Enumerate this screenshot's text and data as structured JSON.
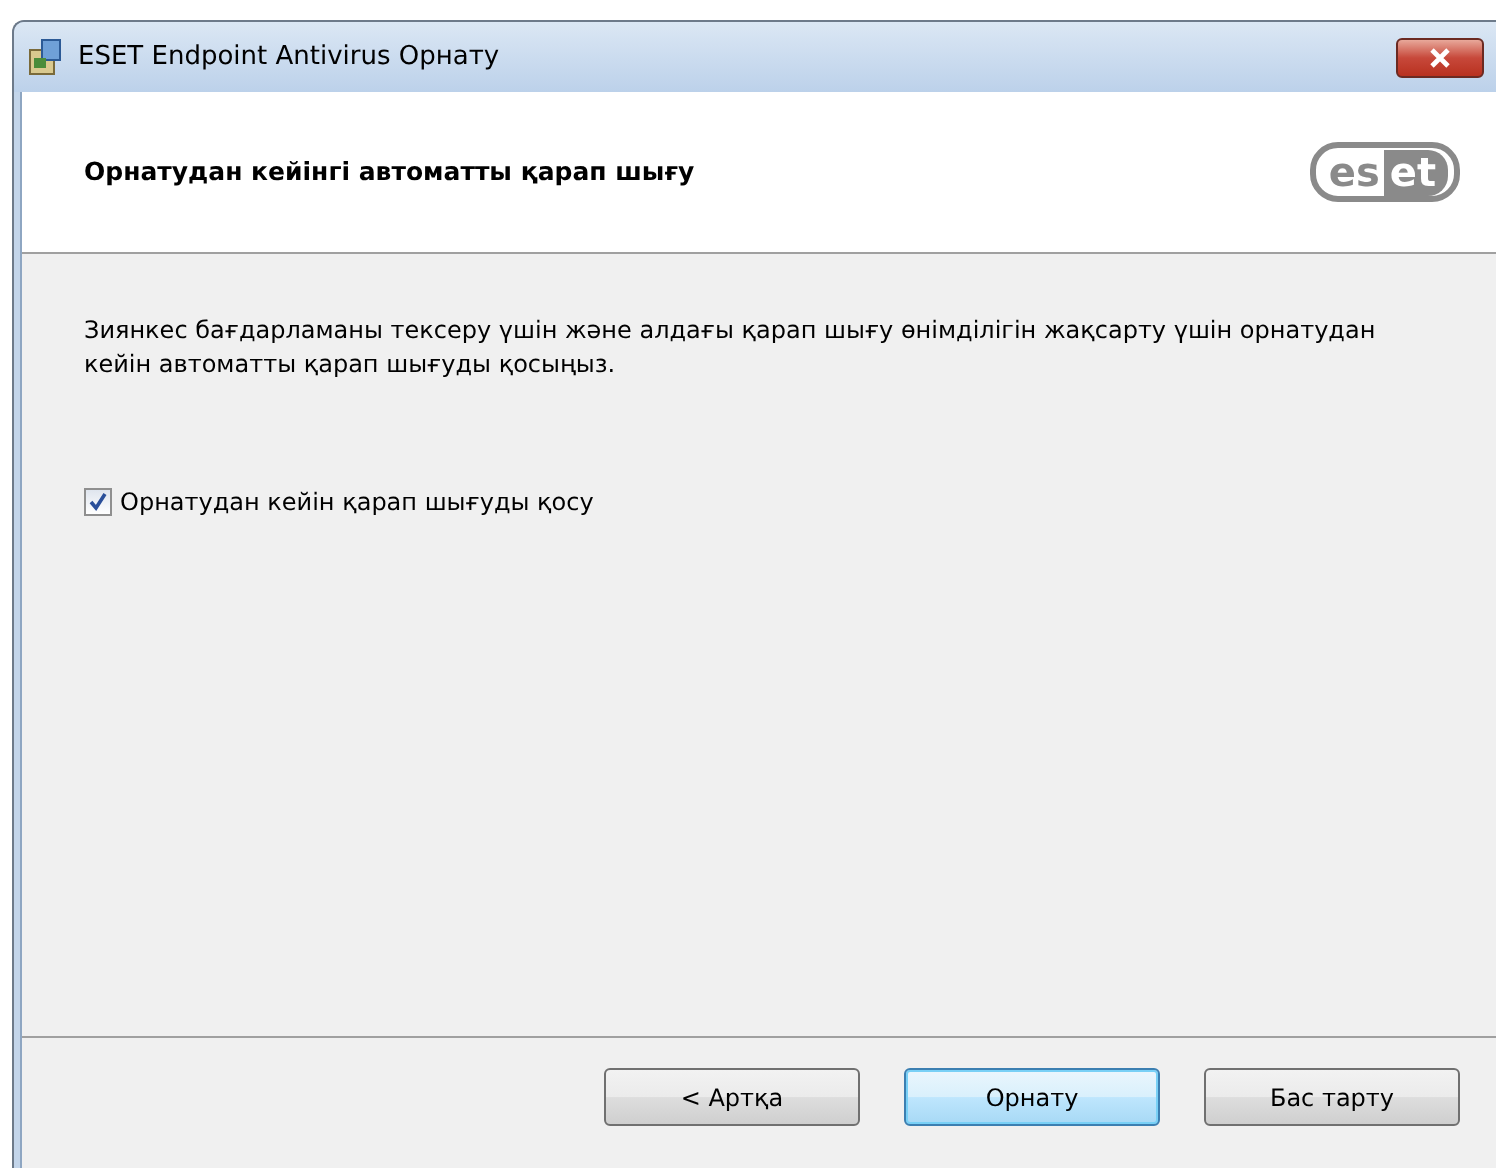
{
  "window": {
    "title": "ESET Endpoint Antivirus Орнату"
  },
  "header": {
    "title": "Орнатудан кейінгі автоматты қарап шығу",
    "logo": [
      "es",
      "et"
    ]
  },
  "description": "Зиянкес бағдарламаны тексеру үшін және алдағы қарап шығу өнімділігін жақсарту үшін орнатудан кейін автоматты қарап шығуды қосыңыз.",
  "checkbox": {
    "label": "Орнатудан кейін қарап шығуды қосу",
    "checked": true
  },
  "buttons": [
    {
      "label": "< Артқа",
      "default": false
    },
    {
      "label": "Орнату",
      "default": true
    },
    {
      "label": "Бас тарту",
      "default": false
    }
  ]
}
